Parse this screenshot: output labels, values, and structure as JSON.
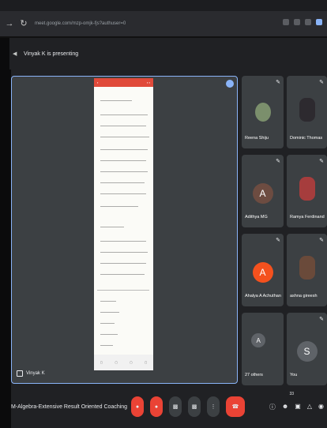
{
  "browser": {
    "url": "meet.google.com/mzp-omjk-fjs?authuser=0"
  },
  "banner": {
    "presenting_text": "Vinyak K is presenting"
  },
  "presentation": {
    "presenter_label": "Vinyak K"
  },
  "participants": [
    {
      "name": "Reena Shiju",
      "type": "photo",
      "color": "#7b8f6c"
    },
    {
      "name": "Dominic Thomas",
      "type": "photo",
      "color": "#2d2a2f"
    },
    {
      "name": "Adithya MG",
      "type": "initial",
      "initial": "A",
      "color": "#6d4c41"
    },
    {
      "name": "Ramya Ferdinand",
      "type": "photo",
      "color": "#a63d3d"
    },
    {
      "name": "Ahalya A Achuthan",
      "type": "initial",
      "initial": "A",
      "color": "#f4511e"
    },
    {
      "name": "ashna gireesh",
      "type": "photo",
      "color": "#6a4a3a"
    },
    {
      "name": "27 others",
      "type": "group",
      "initial": "A",
      "color": "#5f6368"
    },
    {
      "name": "You",
      "type": "initial",
      "initial": "S",
      "color": "#5f6368"
    }
  ],
  "bottom": {
    "meeting_title": "M-Algebra-Extensive Result Oriented Coaching",
    "participant_count": "33"
  },
  "colors": {
    "accent": "#8ab4f8",
    "end_call": "#ea4335",
    "background": "#202124"
  }
}
